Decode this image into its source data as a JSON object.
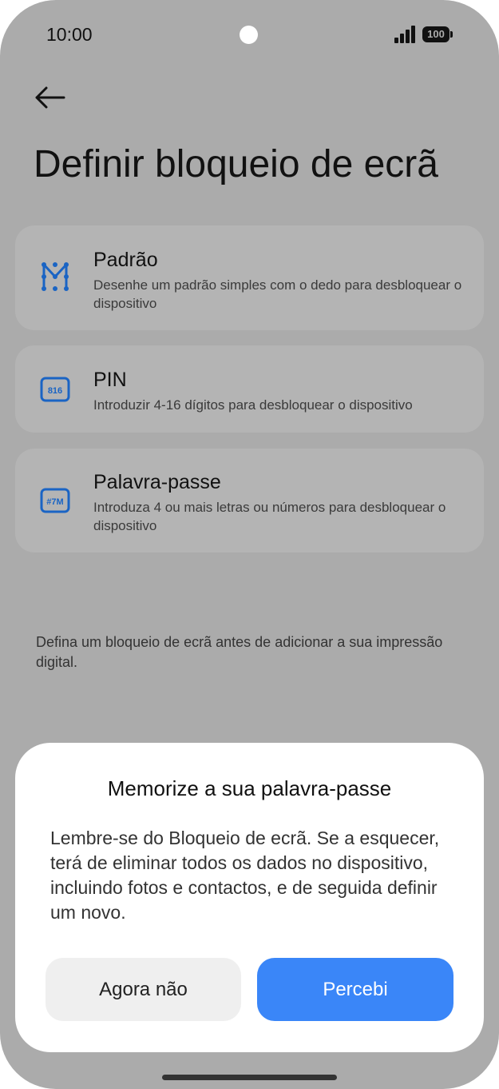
{
  "status": {
    "time": "10:00",
    "battery": "100"
  },
  "header": {
    "title": "Definir bloqueio de ecrã"
  },
  "options": [
    {
      "title": "Padrão",
      "description": "Desenhe um padrão simples com o dedo para desbloquear o dispositivo",
      "icon": "pattern-icon"
    },
    {
      "title": "PIN",
      "description": "Introduzir 4-16 dígitos para desbloquear o dispositivo",
      "icon": "pin-icon",
      "icon_text": "816"
    },
    {
      "title": "Palavra-passe",
      "description": "Introduza 4 ou mais letras ou números para desbloquear o dispositivo",
      "icon": "password-icon",
      "icon_text": "#7M"
    }
  ],
  "note": "Defina um bloqueio de ecrã antes de adicionar a sua impressão digital.",
  "dialog": {
    "title": "Memorize a sua palavra-passe",
    "body": "Lembre-se do Bloqueio de ecrã. Se a esquecer, terá de eliminar todos os dados no dispositivo, incluindo fotos e contactos, e de seguida definir um novo.",
    "cancel_label": "Agora não",
    "confirm_label": "Percebi"
  },
  "colors": {
    "accent": "#3a86f8",
    "icon": "#1a64c4",
    "scrim": "#ababab"
  }
}
